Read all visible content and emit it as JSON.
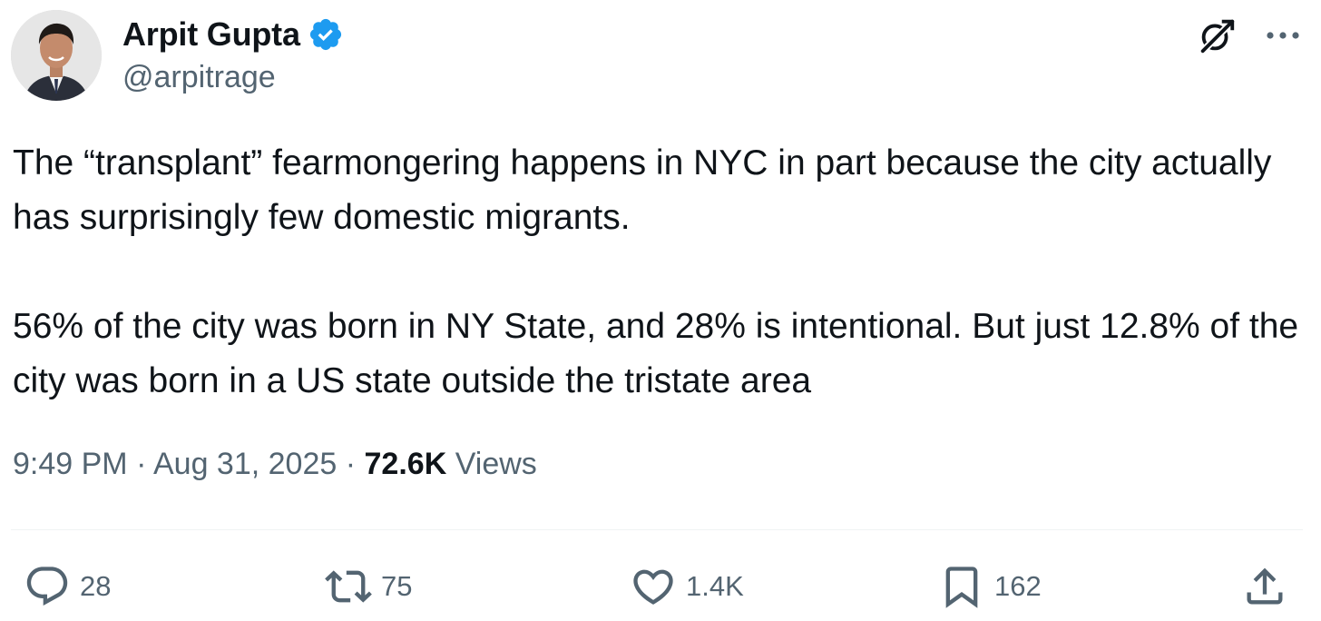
{
  "author": {
    "display_name": "Arpit Gupta",
    "handle": "@arpitrage",
    "verified": true
  },
  "tweet": {
    "text": "The “transplant” fearmongering happens in NYC in part because the city actually has surprisingly few domestic migrants.\n\n56% of the city was born in NY State, and 28% is intentional. But just 12.8% of the city was born in a US state outside the tristate area",
    "time": "9:49 PM",
    "date": "Aug 31, 2025",
    "separator": "·",
    "views_count": "72.6K",
    "views_label": "Views"
  },
  "actions": {
    "replies": "28",
    "reposts": "75",
    "likes": "1.4K",
    "bookmarks": "162"
  },
  "colors": {
    "verified_blue": "#1d9bf0",
    "text_primary": "#0f1419",
    "text_secondary": "#536471"
  },
  "icons": {
    "verified": "verified-badge-icon",
    "grok": "grok-icon",
    "more": "more-icon",
    "reply": "reply-icon",
    "retweet": "retweet-icon",
    "like": "heart-icon",
    "bookmark": "bookmark-icon",
    "share": "share-icon"
  }
}
